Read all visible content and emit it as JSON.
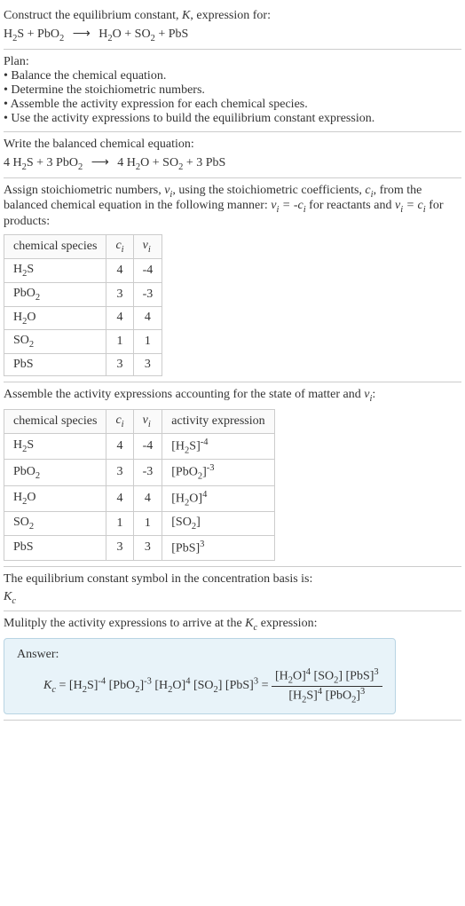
{
  "intro": {
    "line1_pre": "Construct the equilibrium constant, ",
    "line1_k": "K",
    "line1_post": ", expression for:"
  },
  "plan": {
    "heading": "Plan:",
    "items": [
      "Balance the chemical equation.",
      "Determine the stoichiometric numbers.",
      "Assemble the activity expression for each chemical species.",
      "Use the activity expressions to build the equilibrium constant expression."
    ]
  },
  "balanced_heading": "Write the balanced chemical equation:",
  "stoich": {
    "text1": "Assign stoichiometric numbers, ",
    "text2": ", using the stoichiometric coefficients, ",
    "text3": ", from the balanced chemical equation in the following manner: ",
    "text4": " for reactants and ",
    "text5": " for products:"
  },
  "table1": {
    "headers": [
      "chemical species",
      "c_i",
      "ν_i"
    ],
    "rows": [
      {
        "species": "H2S",
        "c": "4",
        "v": "-4"
      },
      {
        "species": "PbO2",
        "c": "3",
        "v": "-3"
      },
      {
        "species": "H2O",
        "c": "4",
        "v": "4"
      },
      {
        "species": "SO2",
        "c": "1",
        "v": "1"
      },
      {
        "species": "PbS",
        "c": "3",
        "v": "3"
      }
    ]
  },
  "activity_heading_pre": "Assemble the activity expressions accounting for the state of matter and ",
  "activity_heading_post": ":",
  "table2": {
    "headers": [
      "chemical species",
      "c_i",
      "ν_i",
      "activity expression"
    ],
    "rows": [
      {
        "species": "H2S",
        "c": "4",
        "v": "-4",
        "act_base": "[H2S]",
        "act_exp": "-4"
      },
      {
        "species": "PbO2",
        "c": "3",
        "v": "-3",
        "act_base": "[PbO2]",
        "act_exp": "-3"
      },
      {
        "species": "H2O",
        "c": "4",
        "v": "4",
        "act_base": "[H2O]",
        "act_exp": "4"
      },
      {
        "species": "SO2",
        "c": "1",
        "v": "1",
        "act_base": "[SO2]",
        "act_exp": ""
      },
      {
        "species": "PbS",
        "c": "3",
        "v": "3",
        "act_base": "[PbS]",
        "act_exp": "3"
      }
    ]
  },
  "eq_symbol_line": "The equilibrium constant symbol in the concentration basis is:",
  "multiply_line_pre": "Mulitply the activity expressions to arrive at the ",
  "multiply_line_post": " expression:",
  "answer_label": "Answer:"
}
